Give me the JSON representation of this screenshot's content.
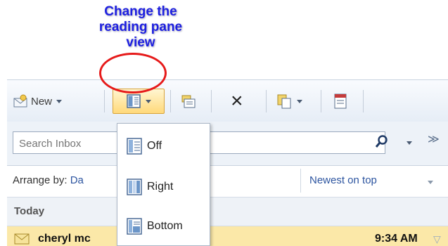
{
  "callout": {
    "lines": [
      "Change the",
      "reading pane",
      "view"
    ],
    "text_color": "#1d1fe0",
    "ring_color": "#e61a1a"
  },
  "toolbar": {
    "new_label": "New",
    "icons": [
      "new-mail-icon",
      "reading-pane-icon",
      "move-to-folder-icon",
      "delete-icon",
      "copy-icon",
      "address-book-icon"
    ]
  },
  "search": {
    "placeholder": "Search Inbox"
  },
  "arrange": {
    "label": "Arrange by:",
    "value_partial": "Da",
    "sort_label": "Newest on top"
  },
  "group": {
    "label": "Today"
  },
  "message": {
    "from_partial": "cheryl mc",
    "time": "9:34 AM",
    "highlight_color": "#fbe8a8"
  },
  "menu": {
    "items": [
      {
        "label": "Off",
        "icon": "pane-off-icon"
      },
      {
        "label": "Right",
        "icon": "pane-right-icon"
      },
      {
        "label": "Bottom",
        "icon": "pane-bottom-icon"
      }
    ]
  }
}
